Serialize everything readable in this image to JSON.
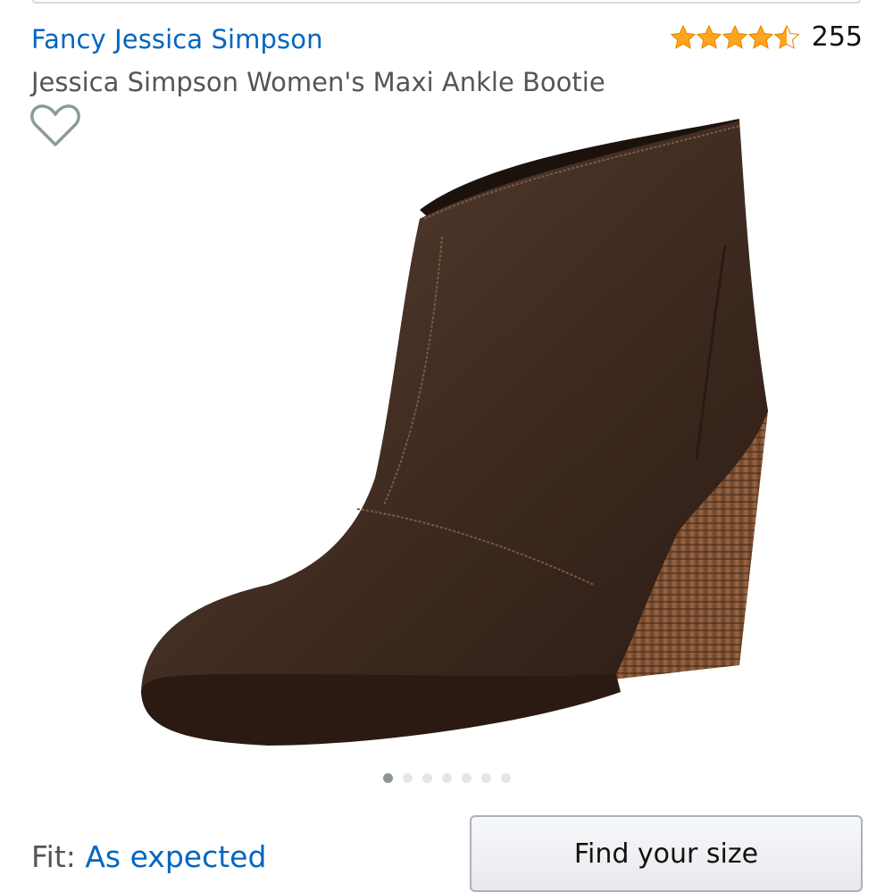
{
  "brand": {
    "link_text": "Fancy Jessica Simpson"
  },
  "rating": {
    "stars": 4.5,
    "review_count": "255",
    "star_color": "#ffa41c"
  },
  "product": {
    "title": "Jessica Simpson Women's Maxi Ankle Bootie"
  },
  "image": {
    "icon": "brown-ankle-bootie-photo"
  },
  "carousel": {
    "total_images": 7,
    "current_index": 1
  },
  "fit": {
    "label": "Fit:",
    "value": "As expected"
  },
  "size_button": {
    "label": "Find your size"
  },
  "colors": {
    "link": "#0066c0",
    "secondary_text": "#555555",
    "accent": "#ffa41c"
  }
}
